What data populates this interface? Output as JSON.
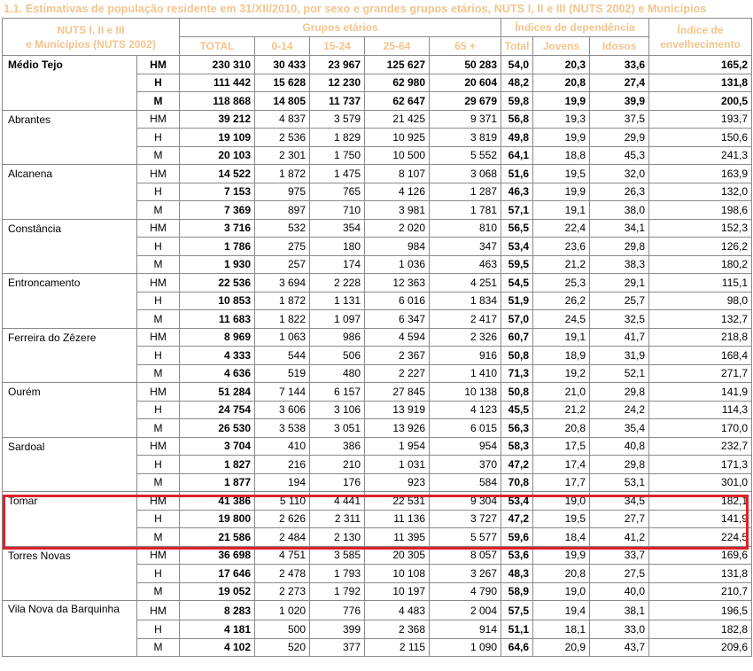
{
  "title": "1.1. Estimativas de população residente em 31/XII/2010, por sexo e grandes grupos etários, NUTS I, II e III (NUTS 2002) e Municípios",
  "header": {
    "nuts_line1": "NUTS I, II e III",
    "nuts_line2": "e Municípios (NUTS 2002)",
    "grupos_etarios": "Grupos etários",
    "indices_dependencia": "Índices de dependência",
    "indice_envelhecimento": "Índice de envelhecimento",
    "sub": [
      "TOTAL",
      "0-14",
      "15-24",
      "25-64",
      "65 +",
      "Total",
      "Jovens",
      "Idosos"
    ]
  },
  "rows": [
    {
      "name": "Médio Tejo",
      "sex": "HM",
      "v": [
        "230 310",
        "30 433",
        "23 967",
        "125 627",
        "50 283",
        "54,0",
        "20,3",
        "33,6",
        "165,2"
      ]
    },
    {
      "name": "",
      "sex": "H",
      "v": [
        "111 442",
        "15 628",
        "12 230",
        "62 980",
        "20 604",
        "48,2",
        "20,8",
        "27,4",
        "131,8"
      ]
    },
    {
      "name": "",
      "sex": "M",
      "v": [
        "118 868",
        "14 805",
        "11 737",
        "62 647",
        "29 679",
        "59,8",
        "19,9",
        "39,9",
        "200,5"
      ]
    },
    {
      "name": "Abrantes",
      "sex": "HM",
      "v": [
        "39 212",
        "4 837",
        "3 579",
        "21 425",
        "9 371",
        "56,8",
        "19,3",
        "37,5",
        "193,7"
      ]
    },
    {
      "name": "",
      "sex": "H",
      "v": [
        "19 109",
        "2 536",
        "1 829",
        "10 925",
        "3 819",
        "49,8",
        "19,9",
        "29,9",
        "150,6"
      ]
    },
    {
      "name": "",
      "sex": "M",
      "v": [
        "20 103",
        "2 301",
        "1 750",
        "10 500",
        "5 552",
        "64,1",
        "18,8",
        "45,3",
        "241,3"
      ]
    },
    {
      "name": "Alcanena",
      "sex": "HM",
      "v": [
        "14 522",
        "1 872",
        "1 475",
        "8 107",
        "3 068",
        "51,6",
        "19,5",
        "32,0",
        "163,9"
      ]
    },
    {
      "name": "",
      "sex": "H",
      "v": [
        "7 153",
        "975",
        "765",
        "4 126",
        "1 287",
        "46,3",
        "19,9",
        "26,3",
        "132,0"
      ]
    },
    {
      "name": "",
      "sex": "M",
      "v": [
        "7 369",
        "897",
        "710",
        "3 981",
        "1 781",
        "57,1",
        "19,1",
        "38,0",
        "198,6"
      ]
    },
    {
      "name": "Constância",
      "sex": "HM",
      "v": [
        "3 716",
        "532",
        "354",
        "2 020",
        "810",
        "56,5",
        "22,4",
        "34,1",
        "152,3"
      ]
    },
    {
      "name": "",
      "sex": "H",
      "v": [
        "1 786",
        "275",
        "180",
        "984",
        "347",
        "53,4",
        "23,6",
        "29,8",
        "126,2"
      ]
    },
    {
      "name": "",
      "sex": "M",
      "v": [
        "1 930",
        "257",
        "174",
        "1 036",
        "463",
        "59,5",
        "21,2",
        "38,3",
        "180,2"
      ]
    },
    {
      "name": "Entroncamento",
      "sex": "HM",
      "v": [
        "22 536",
        "3 694",
        "2 228",
        "12 363",
        "4 251",
        "54,5",
        "25,3",
        "29,1",
        "115,1"
      ]
    },
    {
      "name": "",
      "sex": "H",
      "v": [
        "10 853",
        "1 872",
        "1 131",
        "6 016",
        "1 834",
        "51,9",
        "26,2",
        "25,7",
        "98,0"
      ]
    },
    {
      "name": "",
      "sex": "M",
      "v": [
        "11 683",
        "1 822",
        "1 097",
        "6 347",
        "2 417",
        "57,0",
        "24,5",
        "32,5",
        "132,7"
      ]
    },
    {
      "name": "Ferreira do Zêzere",
      "sex": "HM",
      "v": [
        "8 969",
        "1 063",
        "986",
        "4 594",
        "2 326",
        "60,7",
        "19,1",
        "41,7",
        "218,8"
      ]
    },
    {
      "name": "",
      "sex": "H",
      "v": [
        "4 333",
        "544",
        "506",
        "2 367",
        "916",
        "50,8",
        "18,9",
        "31,9",
        "168,4"
      ]
    },
    {
      "name": "",
      "sex": "M",
      "v": [
        "4 636",
        "519",
        "480",
        "2 227",
        "1 410",
        "71,3",
        "19,2",
        "52,1",
        "271,7"
      ]
    },
    {
      "name": "Ourém",
      "sex": "HM",
      "v": [
        "51 284",
        "7 144",
        "6 157",
        "27 845",
        "10 138",
        "50,8",
        "21,0",
        "29,8",
        "141,9"
      ]
    },
    {
      "name": "",
      "sex": "H",
      "v": [
        "24 754",
        "3 606",
        "3 106",
        "13 919",
        "4 123",
        "45,5",
        "21,2",
        "24,2",
        "114,3"
      ]
    },
    {
      "name": "",
      "sex": "M",
      "v": [
        "26 530",
        "3 538",
        "3 051",
        "13 926",
        "6 015",
        "56,3",
        "20,8",
        "35,4",
        "170,0"
      ]
    },
    {
      "name": "Sardoal",
      "sex": "HM",
      "v": [
        "3 704",
        "410",
        "386",
        "1 954",
        "954",
        "58,3",
        "17,5",
        "40,8",
        "232,7"
      ]
    },
    {
      "name": "",
      "sex": "H",
      "v": [
        "1 827",
        "216",
        "210",
        "1 031",
        "370",
        "47,2",
        "17,4",
        "29,8",
        "171,3"
      ]
    },
    {
      "name": "",
      "sex": "M",
      "v": [
        "1 877",
        "194",
        "176",
        "923",
        "584",
        "70,8",
        "17,7",
        "53,1",
        "301,0"
      ]
    },
    {
      "name": "Tomar",
      "sex": "HM",
      "v": [
        "41 386",
        "5 110",
        "4 441",
        "22 531",
        "9 304",
        "53,4",
        "19,0",
        "34,5",
        "182,1"
      ]
    },
    {
      "name": "",
      "sex": "H",
      "v": [
        "19 800",
        "2 626",
        "2 311",
        "11 136",
        "3 727",
        "47,2",
        "19,5",
        "27,7",
        "141,9"
      ]
    },
    {
      "name": "",
      "sex": "M",
      "v": [
        "21 586",
        "2 484",
        "2 130",
        "11 395",
        "5 577",
        "59,6",
        "18,4",
        "41,2",
        "224,5"
      ]
    },
    {
      "name": "Torres Novas",
      "sex": "HM",
      "v": [
        "36 698",
        "4 751",
        "3 585",
        "20 305",
        "8 057",
        "53,6",
        "19,9",
        "33,7",
        "169,6"
      ]
    },
    {
      "name": "",
      "sex": "H",
      "v": [
        "17 646",
        "2 478",
        "1 793",
        "10 108",
        "3 267",
        "48,3",
        "20,8",
        "27,5",
        "131,8"
      ]
    },
    {
      "name": "",
      "sex": "M",
      "v": [
        "19 052",
        "2 273",
        "1 792",
        "10 197",
        "4 790",
        "58,9",
        "19,0",
        "40,0",
        "210,7"
      ]
    },
    {
      "name": "Vila Nova da Barquinha",
      "sex": "HM",
      "v": [
        "8 283",
        "1 020",
        "776",
        "4 483",
        "2 004",
        "57,5",
        "19,4",
        "38,1",
        "196,5"
      ]
    },
    {
      "name": "",
      "sex": "H",
      "v": [
        "4 181",
        "500",
        "399",
        "2 368",
        "914",
        "51,1",
        "18,1",
        "33,0",
        "182,8"
      ]
    },
    {
      "name": "",
      "sex": "M",
      "v": [
        "4 102",
        "520",
        "377",
        "2 115",
        "1 090",
        "64,6",
        "20,9",
        "43,7",
        "209,6"
      ]
    }
  ],
  "colors": {
    "header_text": "#f3c48c",
    "highlight_border": "#e0202a",
    "grid": "#8a8a8a"
  }
}
